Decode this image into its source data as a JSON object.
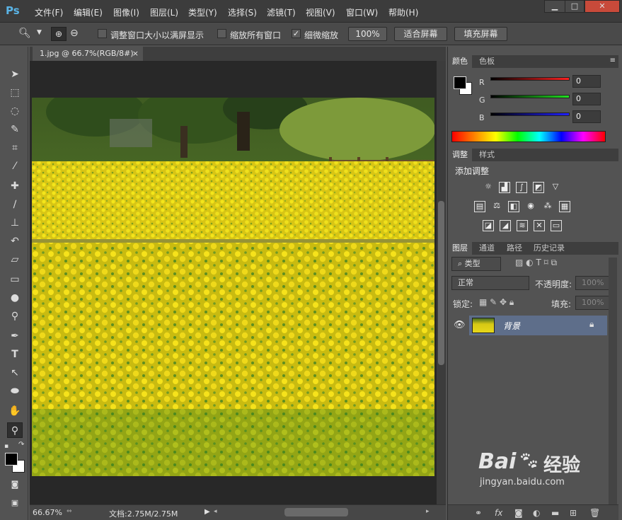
{
  "app": {
    "logo": "Ps"
  },
  "menu": [
    {
      "label": "文件(F)"
    },
    {
      "label": "编辑(E)"
    },
    {
      "label": "图像(I)"
    },
    {
      "label": "图层(L)"
    },
    {
      "label": "类型(Y)"
    },
    {
      "label": "选择(S)"
    },
    {
      "label": "滤镜(T)"
    },
    {
      "label": "视图(V)"
    },
    {
      "label": "窗口(W)"
    },
    {
      "label": "帮助(H)"
    }
  ],
  "window_buttons": {
    "minimize": "▁",
    "maximize": "□",
    "close": "✕"
  },
  "options": {
    "resize_windows": "调整窗口大小以满屏显示",
    "zoom_all": "缩放所有窗口",
    "scrubby_zoom": "细微缩放",
    "scrubby_checked": "✓",
    "btn_100": "100%",
    "btn_fit": "适合屏幕",
    "btn_fill": "填充屏幕"
  },
  "document": {
    "tab_title": "1.jpg @ 66.7%(RGB/8#)",
    "tab_close": "×",
    "zoom": "66.67%",
    "doc_size": "文档:2.75M/2.75M"
  },
  "color_panel": {
    "tabs": [
      "颜色",
      "色板"
    ],
    "channels": [
      {
        "label": "R",
        "value": "0",
        "color": "#ff2020"
      },
      {
        "label": "G",
        "value": "0",
        "color": "#20e020"
      },
      {
        "label": "B",
        "value": "0",
        "color": "#2020ff"
      }
    ]
  },
  "adjust_panel": {
    "tabs": [
      "调整",
      "样式"
    ],
    "title": "添加调整"
  },
  "layers_panel": {
    "tabs": [
      "图层",
      "通道",
      "路径",
      "历史记录"
    ],
    "filter_label": "类型",
    "blend_mode": "正常",
    "opacity_label": "不透明度:",
    "opacity_value": "100%",
    "lock_label": "锁定:",
    "fill_label": "填充:",
    "fill_value": "100%",
    "layers": [
      {
        "name": "背景"
      }
    ]
  },
  "watermark": {
    "text": "Bai",
    "text2": "经验",
    "url": "jingyan.baidu.com"
  }
}
